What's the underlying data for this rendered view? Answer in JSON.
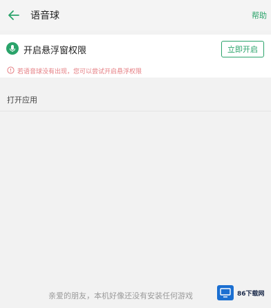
{
  "header": {
    "title": "语音球",
    "help_label": "帮助"
  },
  "permission": {
    "label": "开启悬浮窗权限",
    "button_label": "立即开启"
  },
  "hint": {
    "text": "若语音球没有出现，您可以尝试开启悬浮权限"
  },
  "section": {
    "open_apps_title": "打开应用"
  },
  "footer": {
    "text": "亲爱的朋友，本机好像还没有安装任何游戏"
  },
  "watermark": {
    "text": "86下载网"
  },
  "colors": {
    "accent": "#2aa36a",
    "hint": "#e57d82",
    "background": "#f2f2f2"
  }
}
